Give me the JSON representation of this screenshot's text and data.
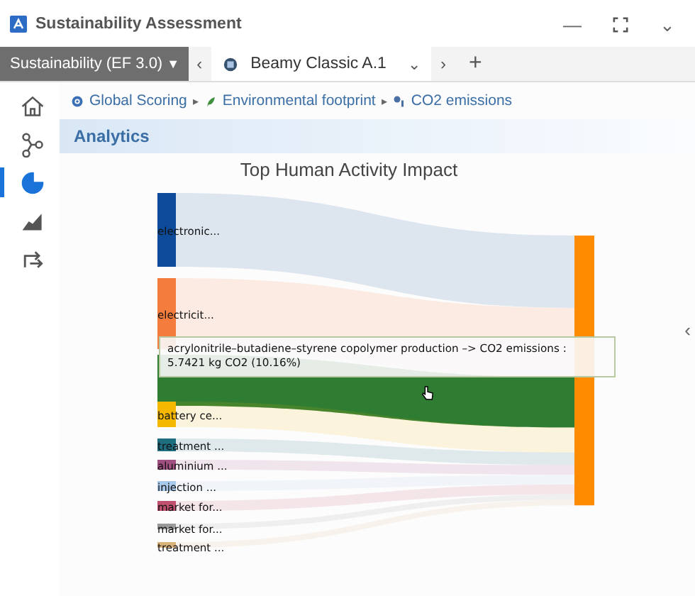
{
  "window": {
    "title": "Sustainability Assessment",
    "controls": [
      "—",
      "⌄"
    ]
  },
  "toolbar": {
    "context": "Sustainability (EF 3.0)",
    "context_caret": "▼",
    "prev": "‹",
    "next": "›",
    "add": "+",
    "tab": {
      "label": "Beamy Classic A.1",
      "caret": "⌄",
      "selected": true
    }
  },
  "breadcrumb": [
    {
      "label": "Global Scoring",
      "sep": "▸"
    },
    {
      "label": "Environmental footprint",
      "sep": "▸"
    },
    {
      "label": "CO2 emissions"
    }
  ],
  "sidebar": {
    "items": [
      {
        "kind": "home",
        "selected": false
      },
      {
        "kind": "graph",
        "selected": false
      },
      {
        "kind": "pie",
        "selected": true
      },
      {
        "kind": "area",
        "selected": false
      },
      {
        "kind": "swap",
        "selected": false
      }
    ]
  },
  "section_title": "Analytics",
  "collapse_handle": "‹",
  "chart": {
    "title": "Top Human Activity Impact",
    "nodes": [
      {
        "label": "electronic...",
        "color": "#0d4a9a",
        "highlighted": false
      },
      {
        "label": "electricit...",
        "color": "#f47c3c",
        "highlighted": false
      },
      {
        "color": "#2e7d32",
        "highlighted": true
      },
      {
        "label": "battery ce...",
        "color": "#f5b800",
        "highlighted": false
      },
      {
        "label": "treatment ...",
        "color": "#1e6e80",
        "highlighted": false
      },
      {
        "label": "aluminium ...",
        "color": "#a05080",
        "highlighted": false
      },
      {
        "label": "injection ...",
        "color": "#a8c8ec",
        "highlighted": false
      },
      {
        "label": "market for...",
        "color": "#c05070",
        "highlighted": false
      },
      {
        "label": "market for...",
        "color": "#9a9a9a",
        "highlighted": false
      },
      {
        "label": "treatment ...",
        "color": "#d9b47a",
        "highlighted": false
      }
    ],
    "tooltip": [
      "acrylonitrile–butadiene–styrene copolymer production –> CO2 emissions :",
      "5.7421 kg CO2 (10.16%)"
    ]
  }
}
